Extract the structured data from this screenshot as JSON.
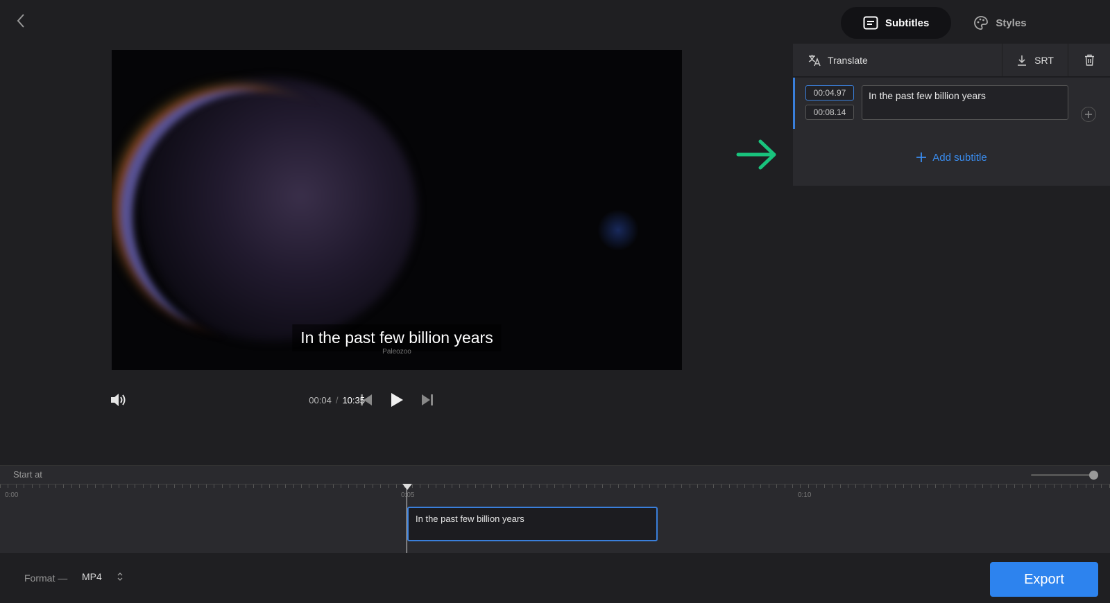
{
  "video": {
    "caption": "In the past few billion years",
    "watermark": "Paleozoo"
  },
  "player": {
    "current_time": "00:04",
    "separator": "/",
    "total_time": "10:35"
  },
  "panel": {
    "tabs": [
      {
        "label": "Subtitles",
        "icon": "subtitles-icon",
        "active": true
      },
      {
        "label": "Styles",
        "icon": "palette-icon",
        "active": false
      }
    ],
    "toolbar": {
      "translate_label": "Translate",
      "srt_label": "SRT"
    },
    "subtitles": [
      {
        "start": "00:04.97",
        "end": "00:08.14",
        "text": "In the past few billion years"
      }
    ],
    "add_subtitle_label": "Add subtitle"
  },
  "timeline": {
    "start_label": "Start at",
    "ticks": [
      "0:00",
      "0:05",
      "0:10"
    ],
    "clip_text": "In the past few billion years"
  },
  "footer": {
    "format_label": "Format —",
    "format_value": "MP4",
    "export_label": "Export"
  },
  "colors": {
    "accent": "#2d83ee",
    "arrow": "#19c37d",
    "background": "#1f1f22"
  }
}
